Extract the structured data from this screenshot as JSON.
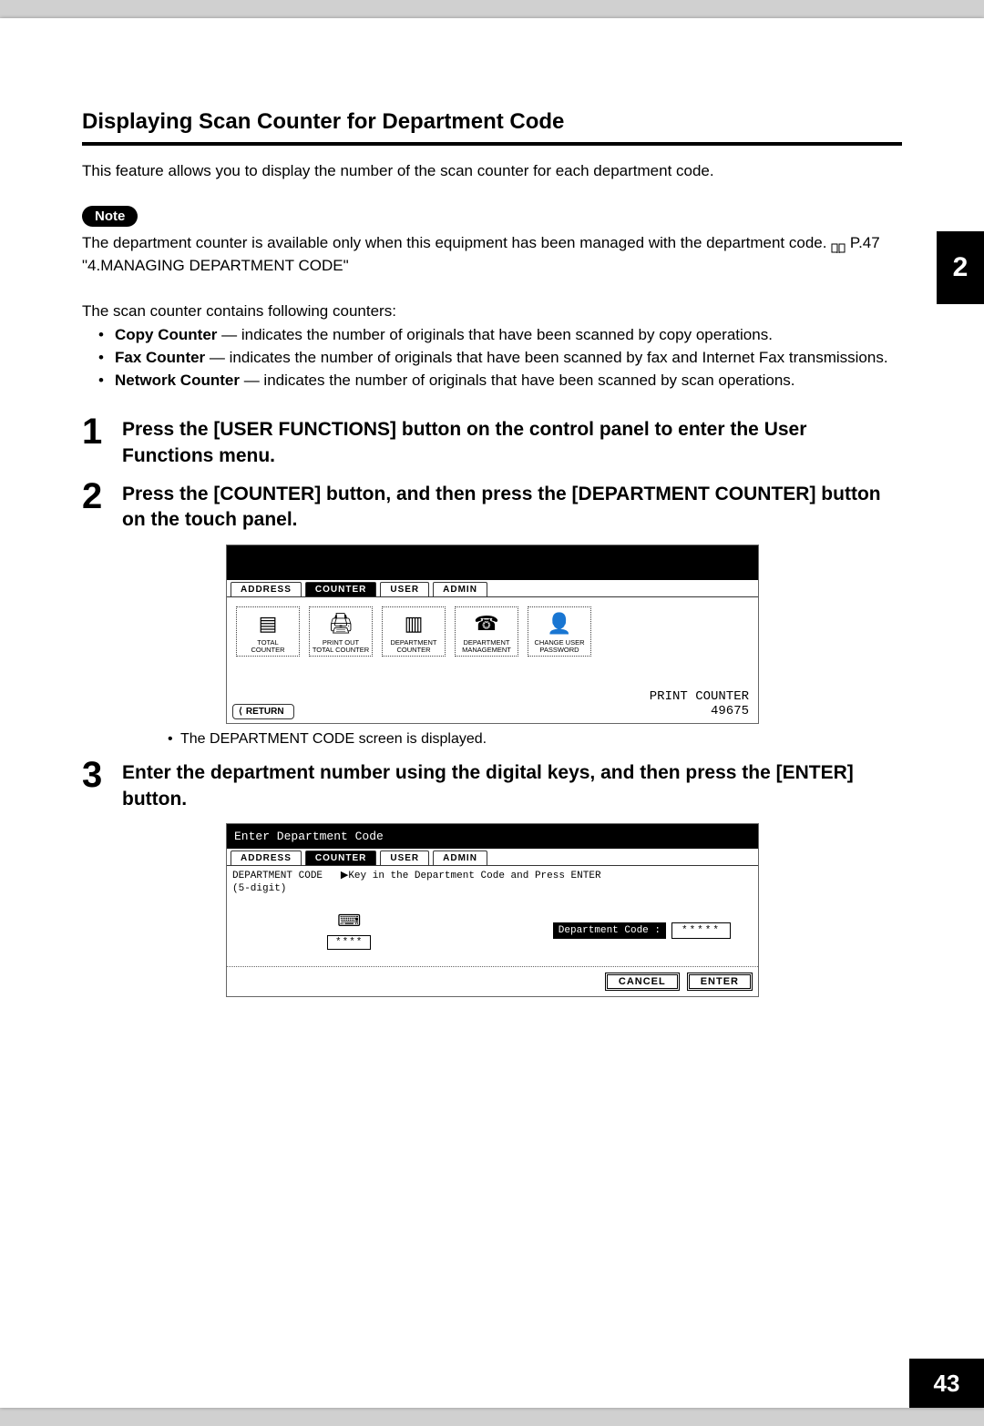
{
  "title": "Displaying Scan Counter for Department Code",
  "intro": "This feature allows you to display the number of the scan counter for each department code.",
  "note_label": "Note",
  "note_text_a": "The department counter is available only when this equipment has been managed with the department code. ",
  "note_text_b": " P.47 \"4.MANAGING DEPARTMENT CODE\"",
  "counters_intro": "The scan counter contains following counters:",
  "counters": [
    {
      "name": "Copy Counter",
      "desc": " — indicates the number of originals that have been scanned by copy operations."
    },
    {
      "name": "Fax Counter",
      "desc": " — indicates the number of originals that have been scanned by fax and Internet Fax transmissions."
    },
    {
      "name": "Network Counter",
      "desc": " — indicates the number of originals that have been scanned by scan operations."
    }
  ],
  "steps": [
    {
      "num": "1",
      "text": "Press the [USER FUNCTIONS] button on the control panel to enter the User Functions menu."
    },
    {
      "num": "2",
      "text": "Press the [COUNTER] button, and then press the [DEPARTMENT COUNTER] button on the touch panel."
    },
    {
      "num": "3",
      "text": "Enter the department number using the digital keys, and then press the [ENTER] button."
    }
  ],
  "step2_sub": "The DEPARTMENT CODE screen is displayed.",
  "ss_tabs": {
    "address": "ADDRESS",
    "counter": "COUNTER",
    "user": "USER",
    "admin": "ADMIN"
  },
  "ss1_buttons": [
    "TOTAL\nCOUNTER",
    "PRINT OUT\nTOTAL COUNTER",
    "DEPARTMENT\nCOUNTER",
    "DEPARTMENT\nMANAGEMENT",
    "CHANGE USER\nPASSWORD"
  ],
  "ss1_print_label": "PRINT COUNTER",
  "ss1_print_value": "49675",
  "ss1_return": "RETURN",
  "ss2_title": "Enter Department Code",
  "ss2_instr_label": "DEPARTMENT CODE",
  "ss2_instr_text": "Key in the Department Code and Press ENTER",
  "ss2_instr_digits": "(5-digit)",
  "ss2_input_mask": "****",
  "ss2_field_label": "Department Code :",
  "ss2_field_value": "*****",
  "ss2_cancel": "CANCEL",
  "ss2_enter": "ENTER",
  "chapter": "2",
  "page_number": "43"
}
